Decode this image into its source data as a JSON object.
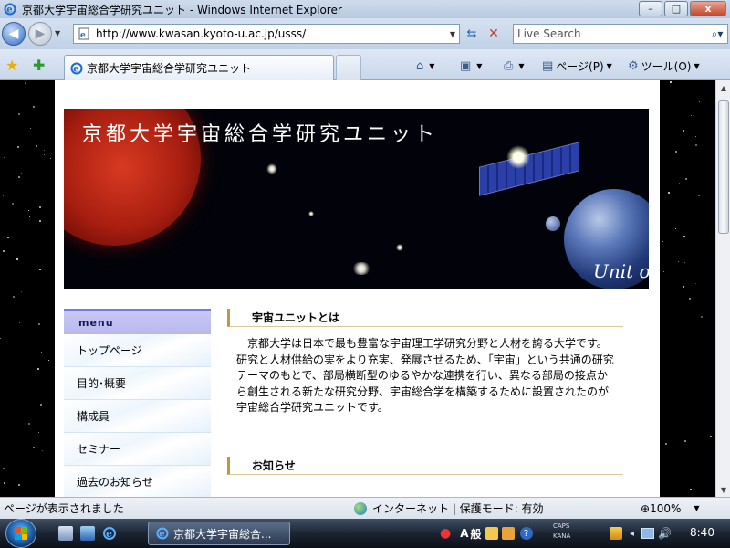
{
  "window": {
    "title": "京都大学宇宙総合学研究ユニット - Windows Internet Explorer",
    "minimize": "–",
    "maximize": "□",
    "close": "x"
  },
  "address_bar": {
    "url": "http://www.kwasan.kyoto-u.ac.jp/usss/",
    "search_placeholder": "Live Search"
  },
  "tabs": {
    "active_label": "京都大学宇宙総合学研究ユニット"
  },
  "command_bar": {
    "page_label": "ページ(P)",
    "tools_label": "ツール(O)"
  },
  "banner": {
    "title": "京都大学宇宙総合学研究ユニット",
    "subtitle": "Unit o"
  },
  "menu": {
    "header": "menu",
    "items": [
      "トップページ",
      "目的･概要",
      "構成員",
      "セミナー",
      "過去のお知らせ"
    ]
  },
  "content": {
    "about_heading": "宇宙ユニットとは",
    "about_text": "京都大学は日本で最も豊富な宇宙理工学研究分野と人材を誇る大学です。研究と人材供給の実をより充実、発展させるため、「宇宙」という共通の研究テーマのもとで、部局横断型のゆるやかな連携を行い、異なる部局の接点から創生される新たな研究分野、宇宙総合学を構築するために設置されたのが宇宙総合学研究ユニットです。",
    "news_heading": "お知らせ"
  },
  "status_bar": {
    "status": "ページが表示されました",
    "zone": "インターネット | 保護モード: 有効",
    "zoom": "100%"
  },
  "taskbar": {
    "task_label": "京都大学宇宙総合...",
    "ime_mode": "A",
    "ime_kanji": "般",
    "caps": "CAPS",
    "kana": "KANA",
    "clock": "8:40"
  },
  "colors": {
    "menu_header": "#c9c9f5",
    "section_accent": "#b89a48",
    "page_bg": "#000000"
  }
}
